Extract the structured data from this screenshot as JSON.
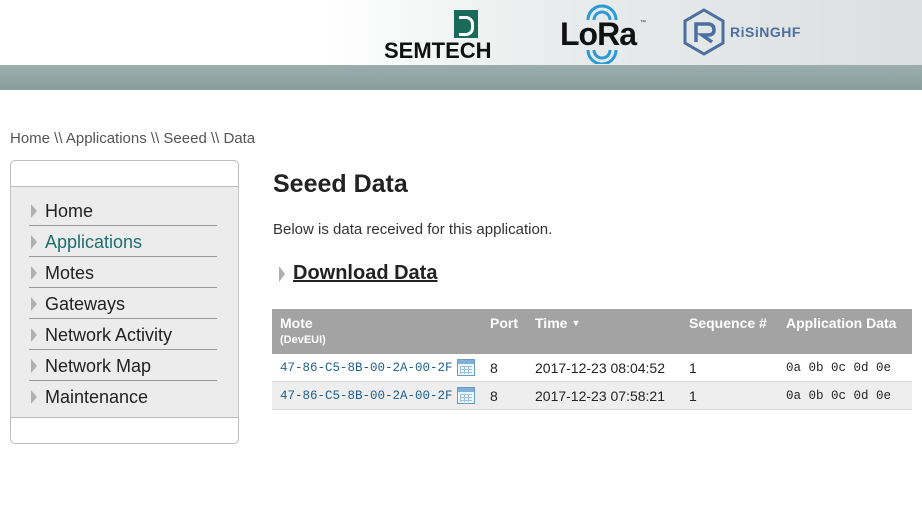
{
  "header": {
    "logos": [
      {
        "name": "semtech-logo",
        "text": "SEMTECH"
      },
      {
        "name": "lora-logo",
        "text": "LoRa",
        "tm": "™"
      },
      {
        "name": "risinghf-logo",
        "text": "RiSiNGHF"
      }
    ],
    "band_color": "#8fa3a3"
  },
  "breadcrumb": "Home \\\\ Applications \\\\ Seeed \\\\ Data",
  "sidebar": {
    "items": [
      {
        "label": "Home",
        "active": false
      },
      {
        "label": "Applications",
        "active": true
      },
      {
        "label": "Motes",
        "active": false
      },
      {
        "label": "Gateways",
        "active": false
      },
      {
        "label": "Network Activity",
        "active": false
      },
      {
        "label": "Network Map",
        "active": false
      },
      {
        "label": "Maintenance",
        "active": false
      }
    ],
    "active_color": "#1f6e6e"
  },
  "main": {
    "title": "Seeed Data",
    "intro": "Below is data received for this application.",
    "download_label": "Download Data"
  },
  "table": {
    "columns": {
      "mote": "Mote",
      "mote_sub": "(DevEUI)",
      "port": "Port",
      "time": "Time",
      "sequence": "Sequence #",
      "app_data": "Application Data"
    },
    "time_sort_icon": "▼",
    "rows": [
      {
        "mote": "47-86-C5-8B-00-2A-00-2F",
        "port": "8",
        "time": "2017-12-23 08:04:52",
        "sequence": "1",
        "app_data": "0a 0b 0c 0d 0e"
      },
      {
        "mote": "47-86-C5-8B-00-2A-00-2F",
        "port": "8",
        "time": "2017-12-23 07:58:21",
        "sequence": "1",
        "app_data": "0a 0b 0c 0d 0e"
      }
    ],
    "header_color": "#a3a3a3",
    "link_color": "#1f5f8f"
  }
}
